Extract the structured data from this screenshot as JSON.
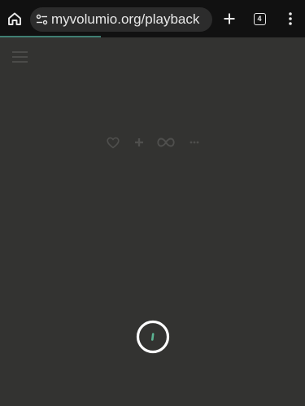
{
  "browser": {
    "url": "myvolumio.org/playback",
    "tab_count": "4",
    "load_progress": 0.33,
    "colors": {
      "toolbar": "#111111",
      "url_pill": "#2c2c2c",
      "progress": "#3f7e72"
    }
  },
  "page": {
    "background": "#333331",
    "menu_icon": "hamburger-icon",
    "actions": [
      {
        "name": "favorite",
        "icon": "heart-icon"
      },
      {
        "name": "add",
        "icon": "plus-icon"
      },
      {
        "name": "repeat",
        "icon": "infinity-icon"
      },
      {
        "name": "more",
        "icon": "ellipsis-icon"
      }
    ],
    "loader": {
      "ring_color": "#ffffff",
      "indicator_color": "#5bb392"
    }
  }
}
